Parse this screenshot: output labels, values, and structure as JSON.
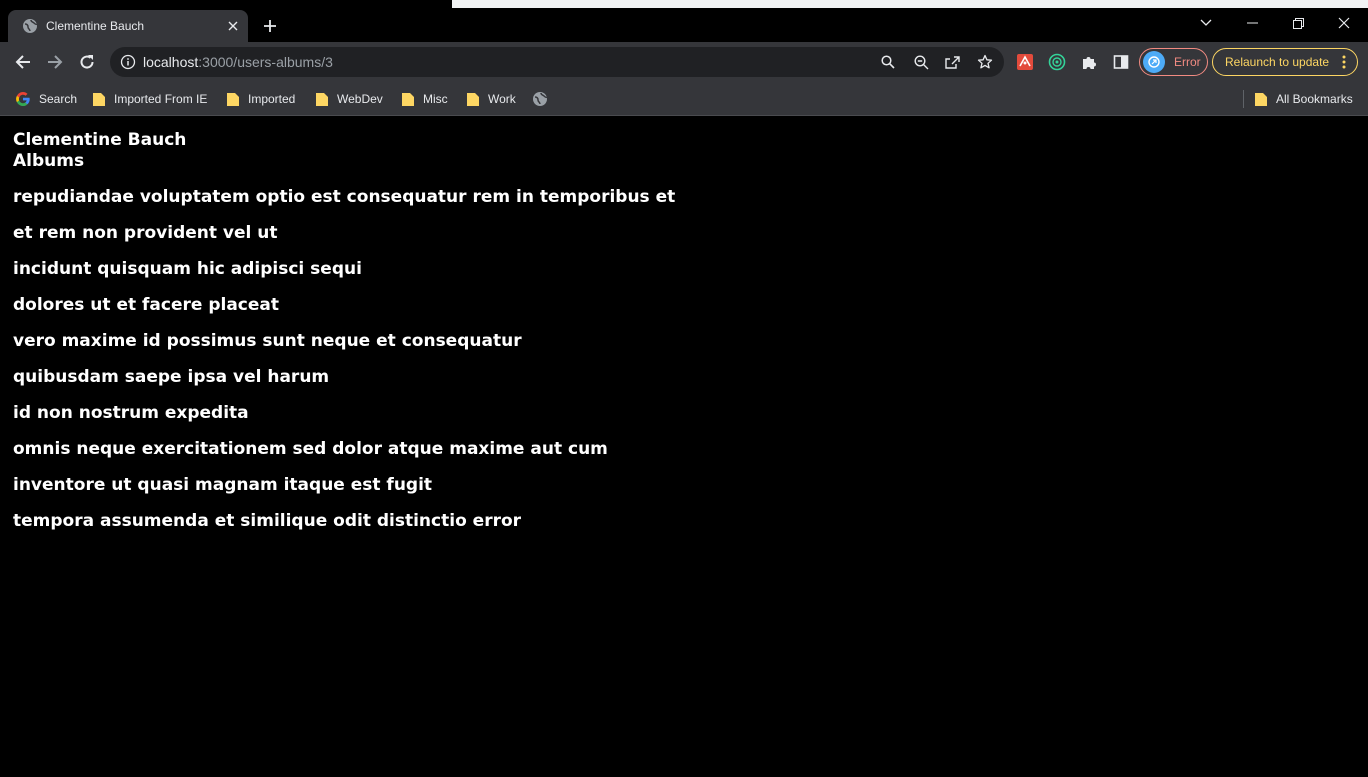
{
  "browser": {
    "tab": {
      "title": "Clementine Bauch"
    },
    "address": {
      "host": "localhost",
      "path": ":3000/users-albums/3"
    },
    "profile": {
      "status": "Error"
    },
    "update_button": "Relaunch to update",
    "bookmarks": [
      {
        "label": "Search",
        "icon": "google-icon"
      },
      {
        "label": "Imported From IE",
        "icon": "folder-icon"
      },
      {
        "label": "Imported",
        "icon": "folder-icon"
      },
      {
        "label": "WebDev",
        "icon": "folder-icon"
      },
      {
        "label": "Misc",
        "icon": "folder-icon"
      },
      {
        "label": "Work",
        "icon": "folder-icon"
      }
    ],
    "all_bookmarks": "All Bookmarks"
  },
  "page": {
    "user_name": "Clementine Bauch",
    "section_title": "Albums",
    "albums": [
      "repudiandae voluptatem optio est consequatur rem in temporibus et",
      "et rem non provident vel ut",
      "incidunt quisquam hic adipisci sequi",
      "dolores ut et facere placeat",
      "vero maxime id possimus sunt neque et consequatur",
      "quibusdam saepe ipsa vel harum",
      "id non nostrum expedita",
      "omnis neque exercitationem sed dolor atque maxime aut cum",
      "inventore ut quasi magnam itaque est fugit",
      "tempora assumenda et similique odit distinctio error"
    ]
  },
  "colors": {
    "page_background": "#000000",
    "chrome_background": "#35363a",
    "error_accent": "#f28b82",
    "update_accent": "#fdd663"
  }
}
